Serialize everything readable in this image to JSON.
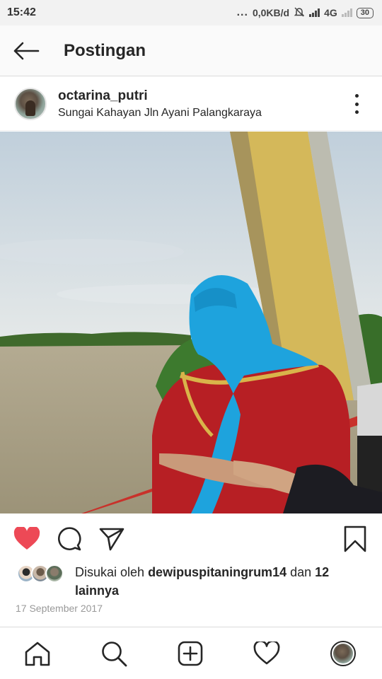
{
  "status_bar": {
    "time": "15:42",
    "dots": "...",
    "network_speed": "0,0KB/d",
    "network_type": "4G",
    "battery": "30"
  },
  "header": {
    "title": "Postingan",
    "back_icon": "arrow-left-icon"
  },
  "post": {
    "username": "octarina_putri",
    "location": "Sungai Kahayan Jln Ayani Palangkaraya",
    "more_icon": "more-vertical-icon",
    "photo_description_icon": "photo",
    "liked": true,
    "likes_prefix": "Disukai oleh ",
    "likes_user": "dewipuspitaningrum14",
    "likes_middle": " dan ",
    "likes_count": "12 lainnya",
    "date": "17 September 2017"
  },
  "actions": {
    "like_icon": "heart-filled-icon",
    "comment_icon": "comment-icon",
    "share_icon": "send-icon",
    "save_icon": "bookmark-icon"
  },
  "nav": {
    "home_icon": "home-icon",
    "search_icon": "search-icon",
    "add_icon": "add-post-icon",
    "activity_icon": "heart-icon",
    "profile_icon": "profile-avatar-icon"
  },
  "colors": {
    "like_red": "#ed4956",
    "text": "#262626",
    "muted": "#999999"
  }
}
